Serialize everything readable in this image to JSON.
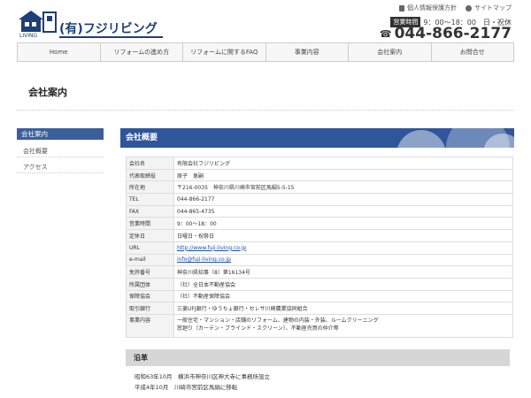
{
  "header": {
    "logo_sub": "LIVING",
    "logo_text": "(有)フジリビング",
    "top_links": [
      "個人情報保護方針",
      "サイトマップ"
    ],
    "hours_badge": "営業時間",
    "hours_text": "9：00～18：00　日・祝休",
    "phone": "044-866-2177"
  },
  "nav": [
    "Home",
    "リフォームの進め方",
    "リフォームに関するFAQ",
    "事業内容",
    "会社案内",
    "お問合せ"
  ],
  "page_title": "会社案内",
  "sidebar": {
    "heading": "会社案内",
    "items": [
      "会社概要",
      "アクセス"
    ]
  },
  "section_title": "会社概要",
  "company_table": [
    {
      "label": "会社名",
      "value": "有限会社フジリビング"
    },
    {
      "label": "代表取締役",
      "value": "原子　恵嗣"
    },
    {
      "label": "所在地",
      "value": "〒216-0035　神奈川県川崎市宮前区馬絹5-5-15"
    },
    {
      "label": "TEL",
      "value": "044-866-2177"
    },
    {
      "label": "FAX",
      "value": "044-865-4735"
    },
    {
      "label": "営業時間",
      "value": "9：00～18：00"
    },
    {
      "label": "定休日",
      "value": "日曜日・祝祭日"
    },
    {
      "label": "URL",
      "value": "http://www.fuji-living.co.jp",
      "link": true
    },
    {
      "label": "e-mail",
      "value": "info@fuji-living.co.jp",
      "link": true
    },
    {
      "label": "免許番号",
      "value": "神奈川県知事（8）第16134号"
    },
    {
      "label": "所属団体",
      "value": "（社）全日本不動産協会"
    },
    {
      "label": "保障協会",
      "value": "（社）不動産保障協会"
    },
    {
      "label": "取引銀行",
      "value": "三菱UFJ銀行・ゆうちょ銀行・セレサ川崎農業協同組合"
    },
    {
      "label": "事業内容",
      "value": "一般住宅・マンション・店舗のリフォーム、建物の内装・外装、ルームクリーニング",
      "value2": "窓廻り（カーテン・ブラインド・スクリーン）、不動産売買の仲介等"
    }
  ],
  "history": {
    "title": "沿革",
    "items": [
      "昭和63年10月　横浜市神奈川区神大寺に事務所設立",
      "平成4年10月　川崎市宮前区馬絹に移転"
    ]
  },
  "colors": {
    "brand": "#1e3f78",
    "accent": "#2f569b",
    "sidebar": "#3a5f9c"
  }
}
